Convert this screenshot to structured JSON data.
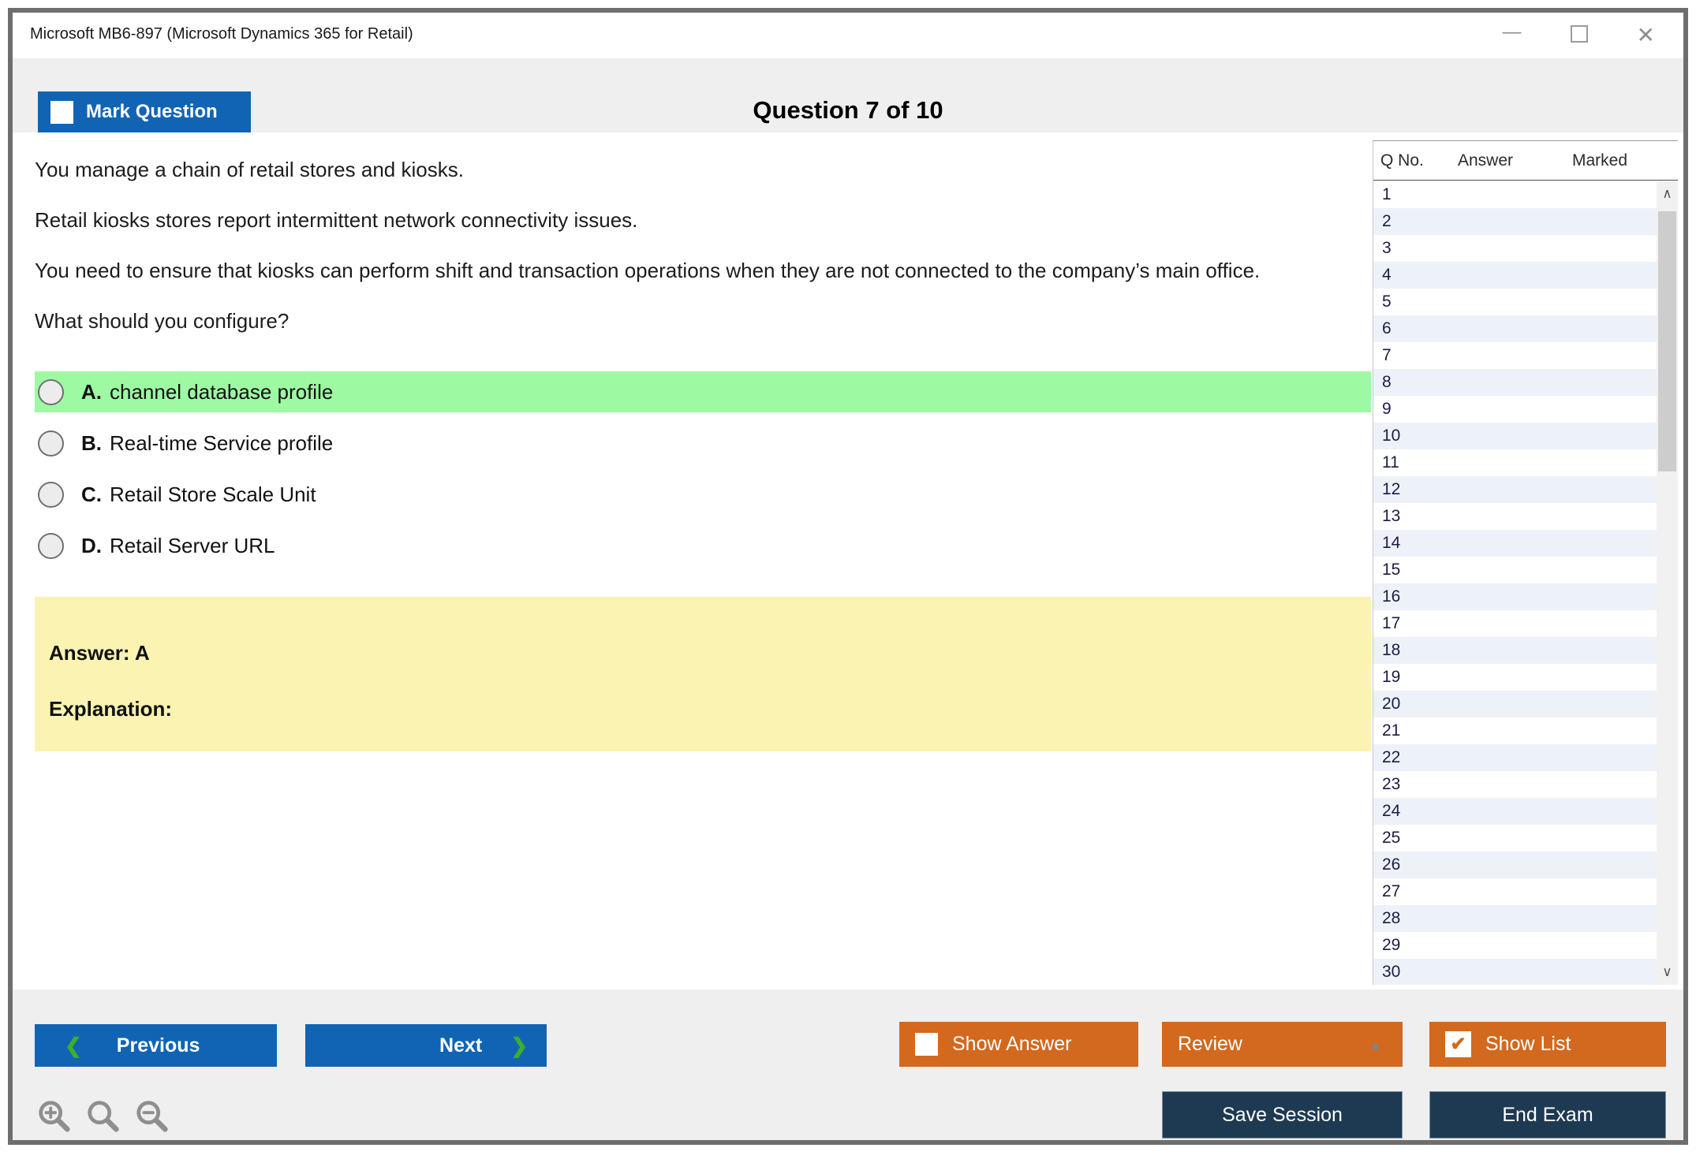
{
  "window": {
    "title": "Microsoft MB6-897 (Microsoft Dynamics 365 for Retail)"
  },
  "icons": {
    "minimize": "—",
    "close": "✕",
    "prev_chevron": "❮",
    "next_chevron": "❯",
    "review_arrow": "▲",
    "scroll_up": "∧",
    "scroll_down": "∨",
    "check": "✔"
  },
  "header": {
    "mark_question_label": "Mark Question",
    "question_counter": "Question 7 of 10"
  },
  "question": {
    "paragraphs": [
      "You manage a chain of retail stores and kiosks.",
      "Retail kiosks stores report intermittent network connectivity issues.",
      "You need to ensure that kiosks can perform shift and transaction operations when they are not connected to the company’s main office.",
      "What should you configure?"
    ],
    "options": [
      {
        "letter": "A.",
        "text": "channel database profile",
        "highlighted": true
      },
      {
        "letter": "B.",
        "text": "Real-time Service profile",
        "highlighted": false
      },
      {
        "letter": "C.",
        "text": "Retail Store Scale Unit",
        "highlighted": false
      },
      {
        "letter": "D.",
        "text": "Retail Server URL",
        "highlighted": false
      }
    ]
  },
  "answer_box": {
    "answer_label": "Answer: A",
    "explanation_label": "Explanation:"
  },
  "sidebar": {
    "columns": [
      "Q No.",
      "Answer",
      "Marked"
    ],
    "rows": [
      "1",
      "2",
      "3",
      "4",
      "5",
      "6",
      "7",
      "8",
      "9",
      "10",
      "11",
      "12",
      "13",
      "14",
      "15",
      "16",
      "17",
      "18",
      "19",
      "20",
      "21",
      "22",
      "23",
      "24",
      "25",
      "26",
      "27",
      "28",
      "29",
      "30"
    ]
  },
  "footer": {
    "previous_label": "Previous",
    "next_label": "Next",
    "show_answer_label": "Show Answer",
    "review_label": "Review",
    "show_list_label": "Show List",
    "save_session_label": "Save Session",
    "end_exam_label": "End Exam"
  },
  "colors": {
    "accent_blue": "#1164b4",
    "accent_orange": "#d2691e",
    "navy": "#1d3a52",
    "highlight_green": "#9efaa2",
    "answer_yellow": "#faf3b1",
    "row_alt": "#edf2f8",
    "chevron_green": "#3cb02c"
  }
}
